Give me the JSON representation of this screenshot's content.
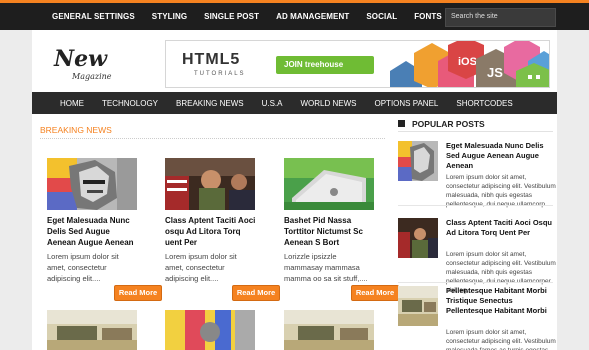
{
  "topnav": {
    "items": [
      "GENERAL SETTINGS",
      "STYLING",
      "SINGLE POST",
      "AD MANAGEMENT",
      "SOCIAL",
      "FONTS"
    ],
    "search_placeholder": "Search the site"
  },
  "logo": {
    "line1": "New",
    "line2": "Magazine"
  },
  "banner": {
    "title": "HTML5",
    "subtitle": "TUTORIALS",
    "button_prefix": "JOIN ",
    "button_brand": "treehouse",
    "hex_labels": [
      "iOS",
      "JS"
    ]
  },
  "mainnav": {
    "items": [
      "HOME",
      "TECHNOLOGY",
      "BREAKING NEWS",
      "U.S.A",
      "WORLD NEWS",
      "OPTIONS PANEL",
      "SHORTCODES"
    ]
  },
  "breaking": {
    "title": "BREAKING NEWS",
    "read_more": "Read More",
    "posts": [
      {
        "title": "Eget Malesuada Nunc Delis Sed Augue Aenean Augue Aenean",
        "excerpt": "Lorem ipsum dolor sit amet, consectetur adipiscing elit...."
      },
      {
        "title": "Class Aptent Taciti Aoci osqu Ad Litora Torq uent Per",
        "excerpt": "Lorem ipsum dolor sit amet, consectetur adipiscing elit...."
      },
      {
        "title": "Bashet Pid Nassa Torttitor Nictumst Sc Aenean S Bort",
        "excerpt": "Lorizzle ipsizzle mammasay mammasa mamma oo sa sit stuff,...."
      }
    ]
  },
  "sidebar": {
    "title": "POPULAR POSTS",
    "posts": [
      {
        "title": "Eget Malesuada Nunc Delis Sed Augue Aenean Augue Aenean",
        "excerpt": "Lorem ipsum dolor sit amet, consectetur adipiscing elit. Vestibulum malesuada, nibh quis egestas pellentesque, dui neque ullamcorp..."
      },
      {
        "title": "Class Aptent Taciti Aoci Osqu Ad Litora Torq Uent Per",
        "excerpt": "Lorem ipsum dolor sit amet, consectetur adipiscing elit. Vestibulum malesuada, nibh quis egestas pellentesque, dui neque ullamcorper nisi, eg..."
      },
      {
        "title": "Pellentesque Habitant Morbi Tristique Senectus Pellentesque Habitant Morbi",
        "excerpt": "Lorem ipsum dolor sit amet, consectetur adipiscing elit. Vestibulum malesuada fames ac turpis egestas. Quisque pellentesque..."
      }
    ]
  },
  "colors": {
    "accent": "#f58220",
    "dark": "#1e1e1e",
    "nav": "#2b2b2b",
    "brand_green": "#6fbc34"
  }
}
